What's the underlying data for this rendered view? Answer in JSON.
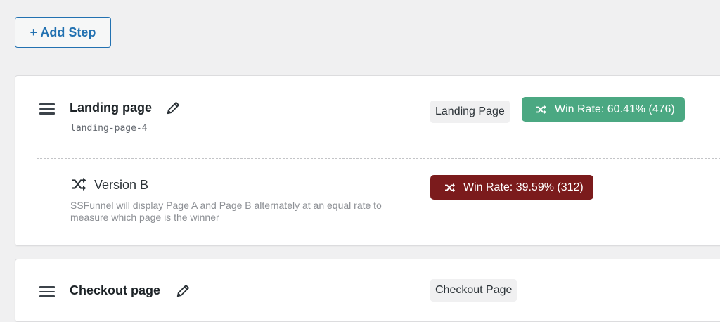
{
  "toolbar": {
    "add_step_label": "+ Add Step"
  },
  "steps": [
    {
      "title": "Landing page",
      "slug": "landing-page-4",
      "type_label": "Landing Page",
      "win_rate_label": "Win Rate: 60.41% (476)",
      "win_rate_color": "#4ba882",
      "version": {
        "label": "Version B",
        "description": "SSFunnel will display Page A and Page B alternately at an equal rate to measure which page is the winner",
        "win_rate_label": "Win Rate: 39.59% (312)",
        "win_rate_color": "#7b1b1c"
      }
    },
    {
      "title": "Checkout page",
      "type_label": "Checkout Page"
    }
  ],
  "icons": {
    "drag": "hamburger-icon",
    "edit": "pencil-icon",
    "split": "shuffle-icon"
  }
}
